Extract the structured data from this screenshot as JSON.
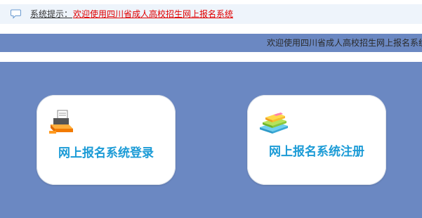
{
  "notice": {
    "label": "系统提示：",
    "message": "欢迎使用四川省成人高校招生网上报名系统"
  },
  "banner": {
    "text": "欢迎使用四川省成人高校招生网上报名系统"
  },
  "cards": {
    "login": {
      "title": "网上报名系统登录",
      "icon": "printer-icon"
    },
    "register": {
      "title": "网上报名系统注册",
      "icon": "books-icon"
    }
  },
  "colors": {
    "panel": "#6b88c2",
    "notice_bg": "#eef4fb",
    "link": "#e00000",
    "card_title": "#1b9bd6"
  }
}
